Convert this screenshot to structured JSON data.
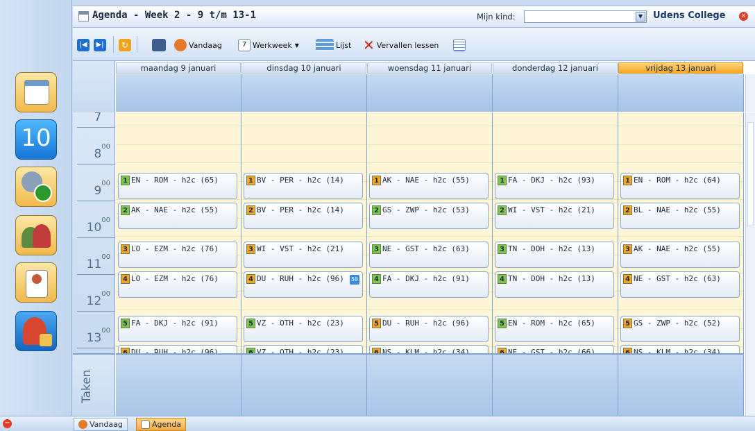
{
  "app": {
    "title": "Agenda - Week 2 - 9 t/m 13-1",
    "child_label": "Mijn kind:",
    "child_value": "",
    "school": "Udens College"
  },
  "toolbar": {
    "today": "Vandaag",
    "workweek": "Werkweek",
    "list": "Lijst",
    "expired": "Vervallen lessen"
  },
  "days": [
    {
      "label": "maandag 9 januari",
      "today": false
    },
    {
      "label": "dinsdag 10 januari",
      "today": false
    },
    {
      "label": "woensdag 11 januari",
      "today": false
    },
    {
      "label": "donderdag 12 januari",
      "today": false
    },
    {
      "label": "vrijdag 13 januari",
      "today": true
    }
  ],
  "hours": [
    "7",
    "8",
    "9",
    "10",
    "11",
    "12",
    "13"
  ],
  "hour_suffix": "00",
  "events": [
    [
      {
        "num": "1",
        "text": "EN - ROM - h2c (65)",
        "color": "#7cc94a"
      },
      {
        "num": "2",
        "text": "AK - NAE - h2c (55)",
        "color": "#7cc94a"
      },
      {
        "num": "3",
        "text": "LO - EZM - h2c (76)",
        "color": "#f5a623"
      },
      {
        "num": "4",
        "text": "LO - EZM - h2c (76)",
        "color": "#f5a623"
      },
      {
        "num": "5",
        "text": "FA - DKJ - h2c (91)",
        "color": "#7cc94a"
      },
      {
        "num": "6",
        "text": "DU - RUH - h2c (96)",
        "color": "#f5a623"
      }
    ],
    [
      {
        "num": "1",
        "text": "BV - PER - h2c (14)",
        "color": "#f5a623"
      },
      {
        "num": "2",
        "text": "BV - PER - h2c (14)",
        "color": "#f5a623"
      },
      {
        "num": "3",
        "text": "WI - VST - h2c (21)",
        "color": "#f5a623"
      },
      {
        "num": "4",
        "text": "DU - RUH - h2c (96)",
        "color": "#f5a623",
        "badge": "50"
      },
      {
        "num": "5",
        "text": "VZ - OTH - h2c (23)",
        "color": "#7cc94a"
      },
      {
        "num": "6",
        "text": "VZ - OTH - h2c (23)",
        "color": "#7cc94a"
      }
    ],
    [
      {
        "num": "1",
        "text": "AK - NAE - h2c (55)",
        "color": "#f5a623"
      },
      {
        "num": "2",
        "text": "GS - ZWP - h2c (53)",
        "color": "#7cc94a"
      },
      {
        "num": "3",
        "text": "NE - GST - h2c (63)",
        "color": "#7cc94a"
      },
      {
        "num": "4",
        "text": "FA - DKJ - h2c (91)",
        "color": "#7cc94a"
      },
      {
        "num": "5",
        "text": "DU - RUH - h2c (96)",
        "color": "#f5a623"
      },
      {
        "num": "6",
        "text": "NS - KLM - h2c (34)",
        "color": "#f5a623"
      }
    ],
    [
      {
        "num": "1",
        "text": "FA - DKJ - h2c (93)",
        "color": "#7cc94a"
      },
      {
        "num": "2",
        "text": "WI - VST - h2c (21)",
        "color": "#7cc94a"
      },
      {
        "num": "3",
        "text": "TN - DOH - h2c (13)",
        "color": "#7cc94a"
      },
      {
        "num": "4",
        "text": "TN - DOH - h2c (13)",
        "color": "#7cc94a"
      },
      {
        "num": "5",
        "text": "EN - ROM - h2c (65)",
        "color": "#7cc94a"
      },
      {
        "num": "6",
        "text": "NE - GST - h2c (66)",
        "color": "#f5a623"
      }
    ],
    [
      {
        "num": "1",
        "text": "EN - ROM - h2c (64)",
        "color": "#f5a623"
      },
      {
        "num": "2",
        "text": "BL - NAE - h2c (55)",
        "color": "#f5a623"
      },
      {
        "num": "3",
        "text": "AK - NAE - h2c (55)",
        "color": "#f5a623"
      },
      {
        "num": "4",
        "text": "NE - GST - h2c (63)",
        "color": "#f5a623"
      },
      {
        "num": "5",
        "text": "GS - ZWP - h2c (52)",
        "color": "#f5a623"
      },
      {
        "num": "6",
        "text": "NS - KLM - h2c (34)",
        "color": "#f5a623"
      }
    ]
  ],
  "taken_label": "Taken",
  "statusbar": {
    "tab_today": "Vandaag",
    "tab_agenda": "Agenda"
  },
  "sidebar": {
    "calendar_day_number": "10"
  },
  "colors": {
    "accent": "#f5a623",
    "green": "#7cc94a",
    "header_blue": "#a6c3e6",
    "slot_yellow": "#fff6d7"
  }
}
